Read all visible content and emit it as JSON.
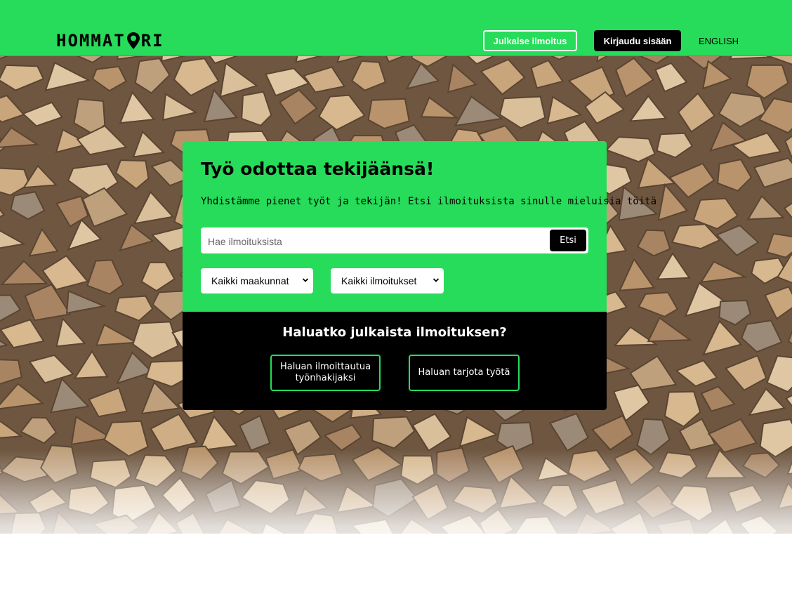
{
  "header": {
    "logo_text_left": "HOMMAT",
    "logo_text_right": "RI",
    "publish_button": "Julkaise ilmoitus",
    "login_button": "Kirjaudu sisään",
    "language_link": "ENGLISH"
  },
  "colors": {
    "brand_green": "#27dc5a",
    "black": "#000000",
    "white": "#ffffff"
  },
  "hero": {
    "background_image": "stacked firewood"
  },
  "search_card": {
    "title": "Työ odottaa tekijäänsä!",
    "subtitle": "Yhdistämme pienet työt ja tekijän! Etsi ilmoituksista sinulle mieluisia töitä",
    "search_placeholder": "Hae ilmoituksista",
    "search_button": "Etsi",
    "region_select": "Kaikki maakunnat",
    "listing_select": "Kaikki ilmoitukset"
  },
  "publish_card": {
    "question": "Haluatko julkaista ilmoituksen?",
    "jobseeker_button": "Haluan ilmoittautua työnhakijaksi",
    "offer_job_button": "Haluan tarjota työtä"
  }
}
